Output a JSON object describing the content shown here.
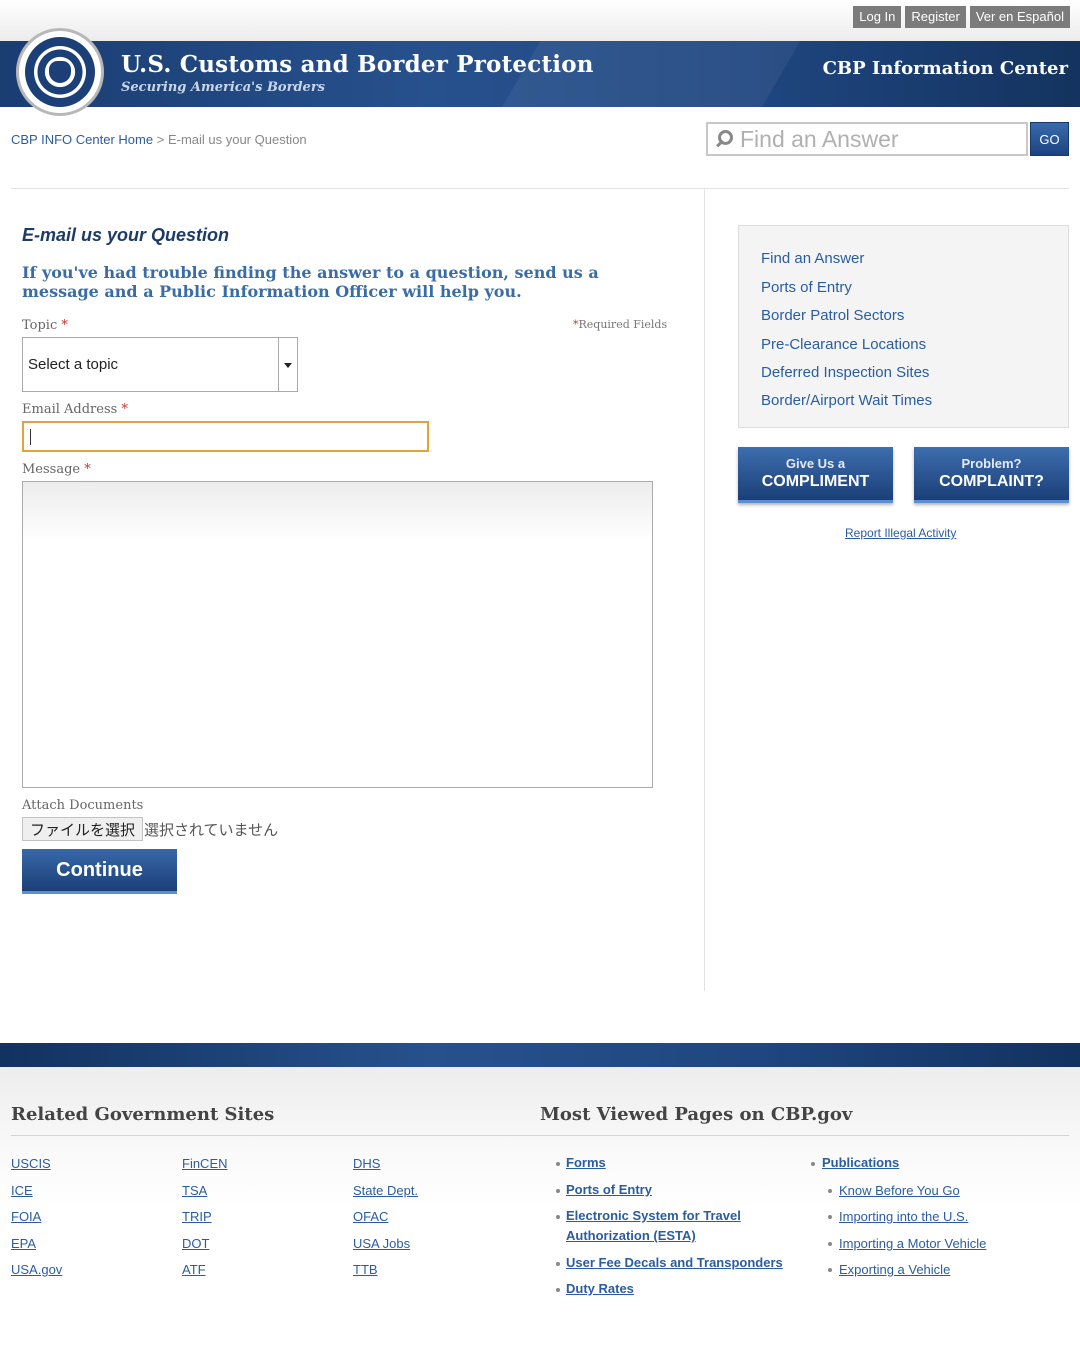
{
  "top_links": [
    "Log In",
    "Register",
    "Ver en Español"
  ],
  "header": {
    "title": "U.S. Customs and Border Protection",
    "tagline": "Securing America's Borders",
    "info_center": "CBP Information Center"
  },
  "breadcrumb": {
    "home": "CBP INFO Center Home",
    "separator": ">",
    "current": "E-mail us your Question"
  },
  "search": {
    "placeholder": "Find an Answer",
    "go_label": "GO"
  },
  "form": {
    "heading": "E-mail us your Question",
    "intro": "If you've had trouble finding the answer to a question, send us a message and a Public Information Officer will help you.",
    "topic_label": "Topic",
    "required_mark": "*",
    "required_note": "Required Fields",
    "topic_selected": "Select a topic",
    "email_label": "Email Address",
    "email_value": "",
    "message_label": "Message",
    "attach_label": "Attach Documents",
    "file_button": "ファイルを選択",
    "file_status": "選択されていません",
    "continue_label": "Continue"
  },
  "sidebar": {
    "links": [
      "Find an Answer",
      "Ports of Entry",
      "Border Patrol Sectors",
      "Pre-Clearance Locations",
      "Deferred Inspection Sites",
      "Border/Airport Wait Times"
    ],
    "compliment": {
      "small": "Give Us a",
      "big": "COMPLIMENT"
    },
    "complaint": {
      "small": "Problem?",
      "big": "COMPLAINT?"
    },
    "report": "Report Illegal Activity"
  },
  "footer": {
    "related_heading": "Related Government Sites",
    "most_viewed_heading": "Most Viewed Pages on CBP.gov",
    "related_col1": [
      "USCIS",
      "ICE",
      "FOIA",
      "EPA",
      "USA.gov"
    ],
    "related_col2": [
      "FinCEN",
      "TSA",
      "TRIP",
      "DOT",
      "ATF"
    ],
    "related_col3": [
      "DHS",
      "State Dept.",
      "OFAC",
      "USA Jobs",
      "TTB"
    ],
    "most_viewed": [
      "Forms",
      "Ports of Entry",
      "Electronic System for Travel Authorization (ESTA)",
      "User Fee Decals and Transponders",
      "Duty Rates"
    ],
    "publications": "Publications",
    "publication_links": [
      "Know Before You Go",
      "Importing into the U.S.",
      "Importing a Motor Vehicle",
      "Exporting a Vehicle"
    ]
  }
}
